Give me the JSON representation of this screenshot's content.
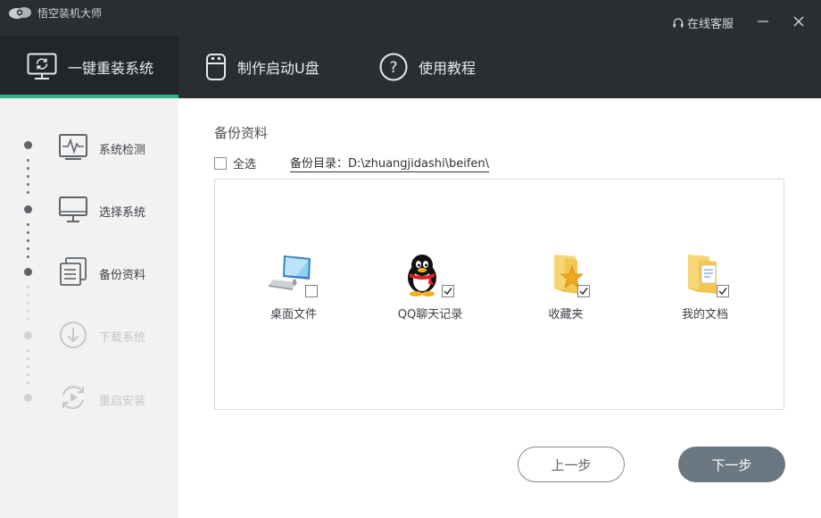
{
  "app": {
    "title": "悟空装机大师",
    "service_label": "在线客服"
  },
  "tabs": [
    {
      "label": "一键重装系统",
      "icon": "monitor-refresh-icon",
      "active": true
    },
    {
      "label": "制作启动U盘",
      "icon": "usb-drive-icon",
      "active": false
    },
    {
      "label": "使用教程",
      "icon": "help-circle-icon",
      "active": false
    }
  ],
  "steps": [
    {
      "label": "系统检测",
      "icon": "pulse-monitor-icon",
      "state": "done"
    },
    {
      "label": "选择系统",
      "icon": "monitor-icon",
      "state": "done"
    },
    {
      "label": "备份资料",
      "icon": "documents-icon",
      "state": "current"
    },
    {
      "label": "下载系统",
      "icon": "download-icon",
      "state": "disabled"
    },
    {
      "label": "重启安装",
      "icon": "restart-icon",
      "state": "disabled"
    }
  ],
  "backup": {
    "title": "备份资料",
    "select_all_label": "全选",
    "select_all_checked": false,
    "directory_text": "备份目录：D:\\zhuangjidashi\\beifen\\",
    "items": [
      {
        "label": "桌面文件",
        "icon": "desktop-computer-icon",
        "checked": false
      },
      {
        "label": "QQ聊天记录",
        "icon": "qq-penguin-icon",
        "checked": true
      },
      {
        "label": "收藏夹",
        "icon": "favorites-folder-icon",
        "checked": true
      },
      {
        "label": "我的文档",
        "icon": "documents-folder-icon",
        "checked": true
      }
    ]
  },
  "buttons": {
    "prev_label": "上一步",
    "next_label": "下一步"
  },
  "colors": {
    "header": "#2a2e33",
    "accent": "#2bb58c",
    "sidebar": "#f2f2f2",
    "primary_button": "#6b7882"
  }
}
